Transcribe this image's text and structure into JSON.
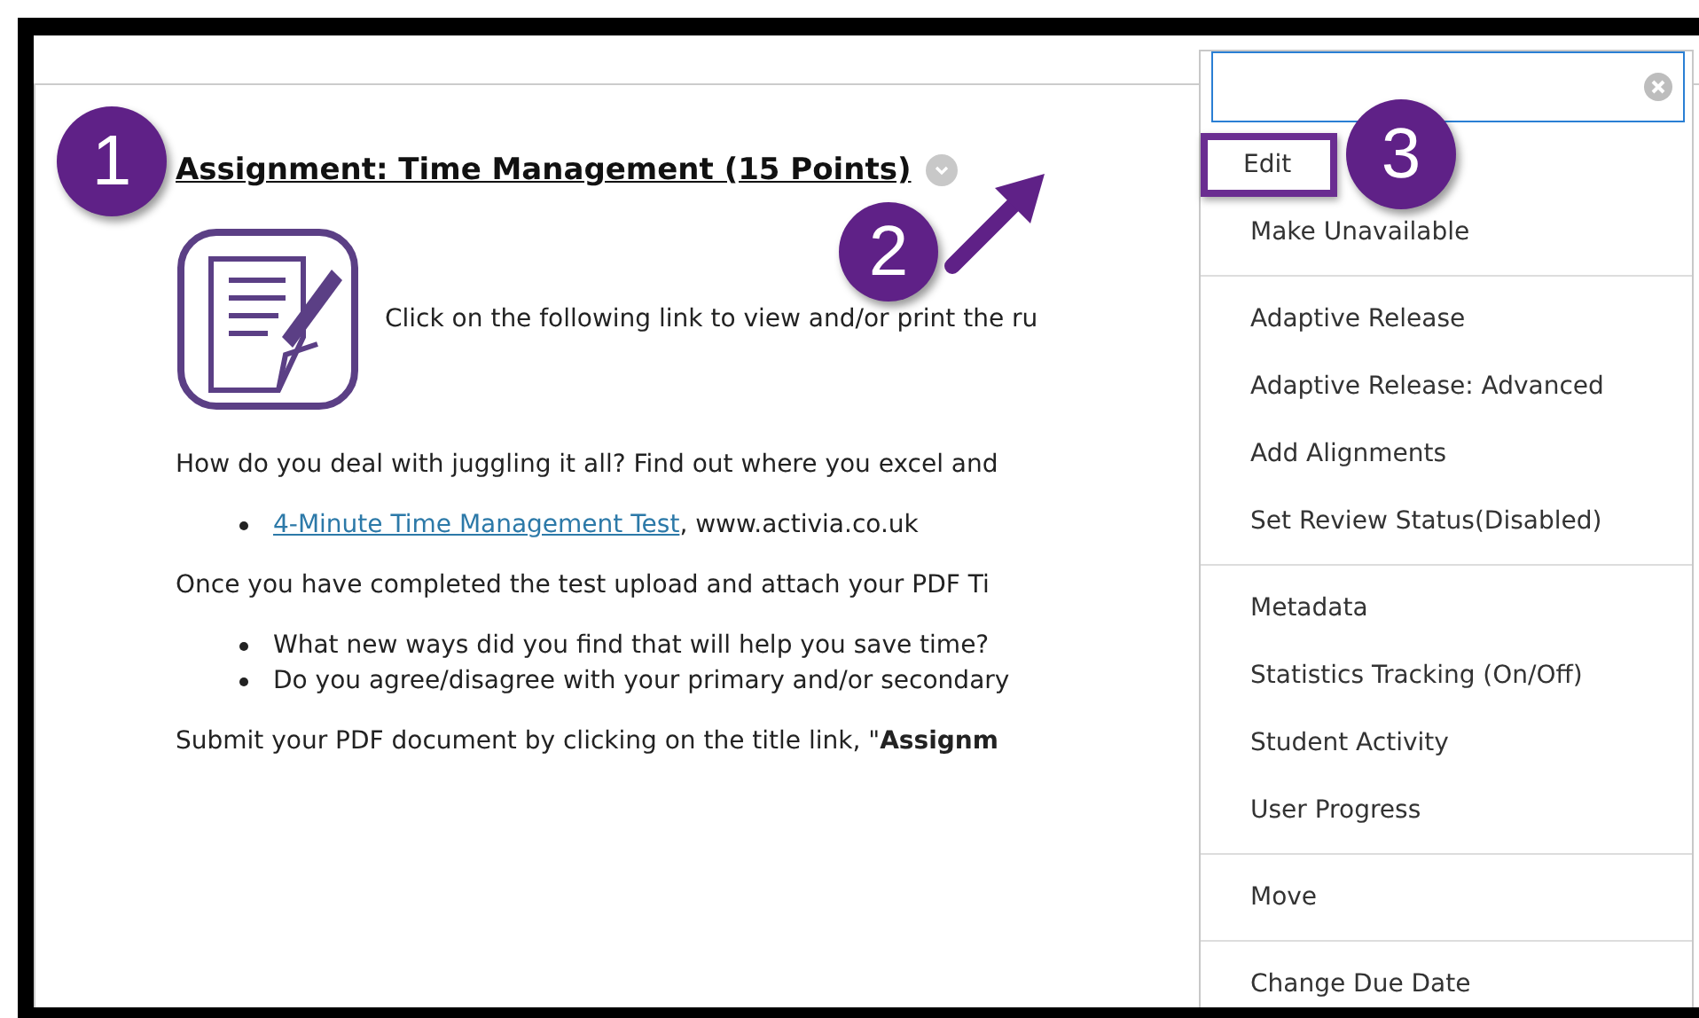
{
  "item": {
    "title": "Assignment: Time Management (15 Points)",
    "intro": "Click on the following link to view and/or print the ru",
    "paragraphs": [
      {
        "kind": "text",
        "text": "How do you deal with juggling it all? Find out where you excel and"
      },
      {
        "kind": "links",
        "items": [
          {
            "link": "4-Minute Time Management Test",
            "rest": ", www.activia.co.uk"
          }
        ]
      },
      {
        "kind": "text",
        "text": "Once you have completed the test upload and attach your PDF Ti"
      },
      {
        "kind": "bullets",
        "items": [
          "What new ways did you find that will help you save time?",
          "Do you agree/disagree with your primary and/or secondary"
        ]
      },
      {
        "kind": "text",
        "text": "Submit your PDF document by clicking on the title link, \"**Assignm**"
      }
    ]
  },
  "menu": {
    "groups": [
      [
        {
          "label": "Edit",
          "highlighted": true
        },
        {
          "label": "Make Unavailable",
          "highlighted": false
        }
      ],
      [
        {
          "label": "Adaptive Release",
          "highlighted": false
        },
        {
          "label": "Adaptive Release: Advanced",
          "highlighted": false
        },
        {
          "label": "Add Alignments",
          "highlighted": false
        },
        {
          "label": "Set Review Status(Disabled)",
          "highlighted": false
        }
      ],
      [
        {
          "label": "Metadata",
          "highlighted": false
        },
        {
          "label": "Statistics Tracking (On/Off)",
          "highlighted": false
        },
        {
          "label": "Student Activity",
          "highlighted": false
        },
        {
          "label": "User Progress",
          "highlighted": false
        }
      ],
      [
        {
          "label": "Move",
          "highlighted": false
        }
      ],
      [
        {
          "label": "Change Due Date",
          "highlighted": false
        }
      ]
    ]
  },
  "callouts": [
    {
      "number": "1"
    },
    {
      "number": "2"
    },
    {
      "number": "3"
    }
  ]
}
